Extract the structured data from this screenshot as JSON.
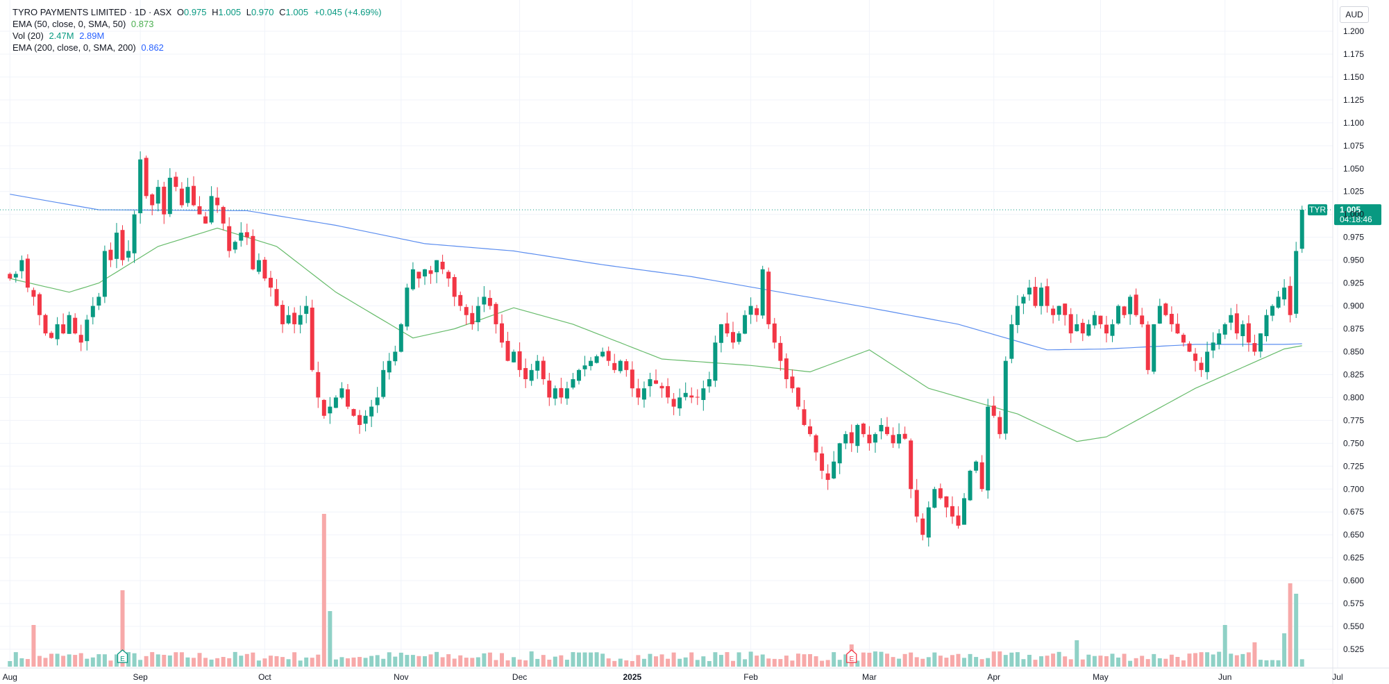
{
  "header": {
    "title": "TYRO PAYMENTS LIMITED · 1D · ASX",
    "ohlc": {
      "o_label": "O",
      "o": "0.975",
      "h_label": "H",
      "h": "1.005",
      "l_label": "L",
      "l": "0.970",
      "c_label": "C",
      "c": "1.005",
      "change": "+0.045 (+4.69%)"
    },
    "indicators": [
      {
        "label": "EMA (50, close, 0, SMA, 50)",
        "value": "0.873",
        "color": "#4caf50"
      },
      {
        "label": "Vol (20)",
        "value": "2.47M",
        "value2": "2.89M",
        "color": "#089981",
        "color2": "#2962ff"
      },
      {
        "label": "EMA (200, close, 0, SMA, 200)",
        "value": "0.862",
        "color": "#2962ff"
      }
    ]
  },
  "currency": "AUD",
  "last_price": {
    "symbol": "TYR",
    "price": "1.005",
    "countdown": "04:18:46"
  },
  "colors": {
    "up": "#089981",
    "down": "#f23645",
    "ema50": "#66bb6a",
    "ema200": "#5b8def",
    "vol_up": "#8fd1c6",
    "vol_down": "#f7a9a9",
    "grid": "#f0f3fa",
    "text": "#131722"
  },
  "chart_data": {
    "type": "candlestick",
    "title": "TYRO PAYMENTS LIMITED · 1D · ASX",
    "ylim": [
      0.505,
      1.215
    ],
    "y_ticks": [
      "1.200",
      "1.175",
      "1.150",
      "1.125",
      "1.100",
      "1.075",
      "1.050",
      "1.025",
      "1.000",
      "0.975",
      "0.950",
      "0.925",
      "0.900",
      "0.875",
      "0.850",
      "0.825",
      "0.800",
      "0.775",
      "0.750",
      "0.725",
      "0.700",
      "0.675",
      "0.650",
      "0.625",
      "0.600",
      "0.575",
      "0.550",
      "0.525"
    ],
    "x_ticks": [
      {
        "label": "Aug",
        "index": 0
      },
      {
        "label": "Sep",
        "index": 22
      },
      {
        "label": "Oct",
        "index": 43
      },
      {
        "label": "Nov",
        "index": 66
      },
      {
        "label": "Dec",
        "index": 86
      },
      {
        "label": "2025",
        "index": 105
      },
      {
        "label": "Feb",
        "index": 125
      },
      {
        "label": "Mar",
        "index": 145
      },
      {
        "label": "Apr",
        "index": 166
      },
      {
        "label": "May",
        "index": 184
      },
      {
        "label": "Jun",
        "index": 205
      },
      {
        "label": "Jul",
        "index": 224
      }
    ],
    "earnings_markers": [
      {
        "index": 19,
        "label": "E"
      },
      {
        "index": 142,
        "label": "E"
      }
    ],
    "closes": [
      0.93,
      0.935,
      0.95,
      0.92,
      0.91,
      0.89,
      0.87,
      0.865,
      0.88,
      0.87,
      0.89,
      0.87,
      0.86,
      0.885,
      0.9,
      0.91,
      0.96,
      0.95,
      0.98,
      0.95,
      0.96,
      1.0,
      1.06,
      1.02,
      1.01,
      1.03,
      1.0,
      1.04,
      1.03,
      1.01,
      1.03,
      1.01,
      1.0,
      0.99,
      1.02,
      1.01,
      0.99,
      0.96,
      0.97,
      0.98,
      0.975,
      0.94,
      0.95,
      0.93,
      0.92,
      0.9,
      0.88,
      0.89,
      0.88,
      0.89,
      0.9,
      0.83,
      0.8,
      0.78,
      0.79,
      0.8,
      0.81,
      0.79,
      0.78,
      0.77,
      0.78,
      0.79,
      0.8,
      0.83,
      0.84,
      0.85,
      0.88,
      0.92,
      0.94,
      0.93,
      0.94,
      0.935,
      0.95,
      0.94,
      0.93,
      0.91,
      0.9,
      0.89,
      0.88,
      0.9,
      0.91,
      0.9,
      0.88,
      0.86,
      0.84,
      0.85,
      0.83,
      0.82,
      0.83,
      0.84,
      0.82,
      0.8,
      0.81,
      0.8,
      0.81,
      0.82,
      0.83,
      0.835,
      0.84,
      0.845,
      0.85,
      0.84,
      0.83,
      0.84,
      0.83,
      0.81,
      0.8,
      0.81,
      0.82,
      0.815,
      0.81,
      0.8,
      0.79,
      0.8,
      0.805,
      0.8,
      0.8,
      0.81,
      0.82,
      0.86,
      0.88,
      0.87,
      0.86,
      0.87,
      0.89,
      0.9,
      0.89,
      0.94,
      0.88,
      0.86,
      0.84,
      0.82,
      0.81,
      0.79,
      0.77,
      0.76,
      0.74,
      0.72,
      0.71,
      0.73,
      0.75,
      0.76,
      0.75,
      0.77,
      0.76,
      0.75,
      0.76,
      0.77,
      0.76,
      0.75,
      0.76,
      0.755,
      0.7,
      0.67,
      0.65,
      0.68,
      0.7,
      0.69,
      0.68,
      0.67,
      0.66,
      0.69,
      0.72,
      0.73,
      0.7,
      0.79,
      0.78,
      0.76,
      0.84,
      0.88,
      0.9,
      0.91,
      0.92,
      0.9,
      0.92,
      0.9,
      0.89,
      0.9,
      0.89,
      0.87,
      0.88,
      0.87,
      0.88,
      0.89,
      0.88,
      0.87,
      0.88,
      0.9,
      0.89,
      0.91,
      0.89,
      0.88,
      0.83,
      0.88,
      0.9,
      0.89,
      0.88,
      0.87,
      0.86,
      0.85,
      0.84,
      0.83,
      0.85,
      0.86,
      0.87,
      0.88,
      0.89,
      0.87,
      0.88,
      0.86,
      0.85,
      0.87,
      0.89,
      0.9,
      0.91,
      0.92,
      0.89,
      0.96,
      1.005
    ],
    "series": [
      {
        "name": "EMA (50, close, 0, SMA, 50)",
        "last_value": 0.873
      },
      {
        "name": "EMA (200, close, 0, SMA, 200)",
        "last_value": 0.862
      },
      {
        "name": "Vol (20)",
        "last_value": "2.47M"
      }
    ],
    "ema200_anchors": [
      [
        0,
        1.022
      ],
      [
        15,
        1.005
      ],
      [
        40,
        1.004
      ],
      [
        55,
        0.988
      ],
      [
        70,
        0.968
      ],
      [
        85,
        0.96
      ],
      [
        100,
        0.945
      ],
      [
        115,
        0.932
      ],
      [
        130,
        0.915
      ],
      [
        145,
        0.898
      ],
      [
        160,
        0.88
      ],
      [
        175,
        0.852
      ],
      [
        185,
        0.853
      ],
      [
        200,
        0.858
      ],
      [
        215,
        0.858
      ],
      [
        232,
        0.862
      ]
    ],
    "ema50_anchors": [
      [
        0,
        0.93
      ],
      [
        10,
        0.915
      ],
      [
        15,
        0.925
      ],
      [
        25,
        0.965
      ],
      [
        35,
        0.985
      ],
      [
        45,
        0.965
      ],
      [
        55,
        0.915
      ],
      [
        68,
        0.865
      ],
      [
        75,
        0.875
      ],
      [
        85,
        0.898
      ],
      [
        95,
        0.88
      ],
      [
        110,
        0.842
      ],
      [
        125,
        0.835
      ],
      [
        135,
        0.828
      ],
      [
        145,
        0.852
      ],
      [
        155,
        0.81
      ],
      [
        170,
        0.782
      ],
      [
        180,
        0.752
      ],
      [
        185,
        0.757
      ],
      [
        200,
        0.81
      ],
      [
        215,
        0.853
      ],
      [
        232,
        0.873
      ]
    ]
  }
}
